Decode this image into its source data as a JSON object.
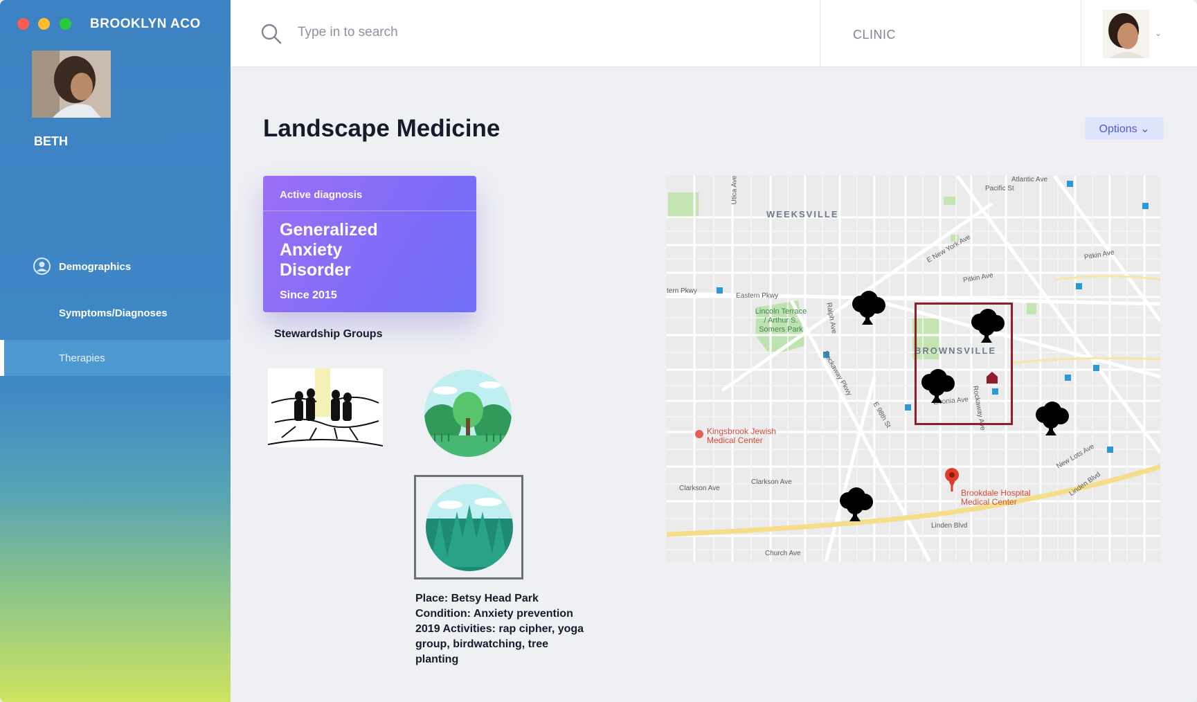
{
  "window": {
    "app_title": "BROOKLYN ACO"
  },
  "sidebar": {
    "patient_name": "BETH",
    "nav": [
      {
        "label": "Demographics",
        "icon": "user-circle-icon",
        "active": false
      },
      {
        "label": "Symptoms/Diagnoses",
        "active": false
      },
      {
        "label": "Therapies",
        "active": true
      }
    ]
  },
  "topbar": {
    "search_placeholder": "Type in to search",
    "clinic_label": "CLINIC"
  },
  "main": {
    "title": "Landscape Medicine",
    "options_label": "Options ⌄",
    "diagnosis_card": {
      "header": "Active diagnosis",
      "title": "Generalized Anxiety Disorder",
      "since": "Since 2015"
    },
    "groups_label": "Stewardship Groups",
    "place_info": {
      "place": "Place: Betsy Head Park",
      "condition": "Condition: Anxiety prevention",
      "activities": "2019 Activities: rap cipher, yoga group, birdwatching, tree planting"
    }
  },
  "map": {
    "labels": {
      "weeksville": "WEEKSVILLE",
      "brownsville": "BROWNSVILLE",
      "park": "Lincoln Terrace / Arthur S. Somers Park",
      "kingsbrook": "Kingsbrook Jewish Medical Center",
      "brookdale": "Brookdale Hospital Medical Center",
      "atlantic": "Atlantic Ave",
      "pacific": "Pacific St",
      "eastern_pkwy": "Eastern Pkwy",
      "eastern_pkwy_w": "tern Pkwy",
      "e_new_york": "E New York Ave",
      "pitkin": "Pitkin Ave",
      "pitkin_e": "Pitkin Ave",
      "clarkson": "Clarkson Ave",
      "clarkson_w": "Clarkson Ave",
      "linden": "Linden Blvd",
      "linden_e": "Linden Blvd",
      "church": "Church Ave",
      "utica": "Utica Ave",
      "ralph": "Ralph Ave",
      "rockaway_pkwy": "Rockaway Pkwy",
      "rockaway_ave": "Rockaway Ave",
      "e98": "E 98th St",
      "new_lots": "New Lots Ave",
      "livonia": "Livonia Ave"
    }
  },
  "colors": {
    "sidebar_blue": "#3d82c2",
    "sidebar_green": "#cfe35e",
    "card_purple": "#8a6ef6",
    "highlight_red": "#8e1e2a",
    "options_text": "#4d5bd6"
  }
}
